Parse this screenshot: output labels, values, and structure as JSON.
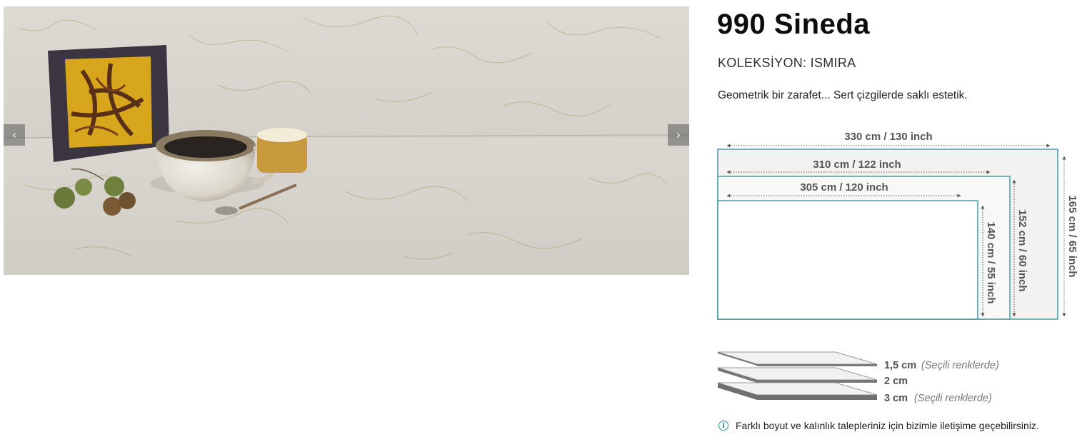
{
  "gallery": {
    "prev_icon": "‹",
    "next_icon": "›",
    "image_description_icon": "product-photo"
  },
  "product": {
    "title": "990 Sineda",
    "collection": "KOLEKSİYON: ISMIRA",
    "tagline": "Geometrik bir zarafet... Sert çizgilerde saklı estetik."
  },
  "dimensions": {
    "large_width": "330 cm / 130 inch",
    "large_height": "165 cm / 65 inch",
    "medium_width": "310 cm / 122 inch",
    "medium_height": "152 cm / 60 inch",
    "small_width": "305 cm / 120 inch",
    "small_height": "140 cm / 55 inch",
    "accent_color": "#2a8f92"
  },
  "thickness": {
    "t1_value": "1,5 cm",
    "t1_note": "(Seçili renklerde)",
    "t2_value": "2 cm",
    "t3_value": "3 cm",
    "t3_note": "(Seçili renklerde)"
  },
  "info": {
    "icon": "i",
    "text": "Farklı boyut ve kalınlık talepleriniz için bizimle iletişime geçebilirsiniz."
  }
}
